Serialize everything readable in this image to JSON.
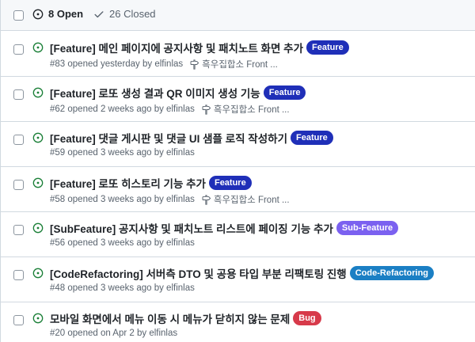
{
  "header": {
    "open_label": "8 Open",
    "closed_label": "26 Closed"
  },
  "issues": [
    {
      "title": "[Feature] 메인 페이지에 공지사항 및 패치노트 화면 추가",
      "label": "Feature",
      "label_color": "#1f2fb8",
      "meta": "#83 opened yesterday by elfinlas",
      "milestone": "흑우집합소 Front ..."
    },
    {
      "title": "[Feature] 로또 생성 결과 QR 이미지 생성 기능",
      "label": "Feature",
      "label_color": "#1f2fb8",
      "meta": "#62 opened 2 weeks ago by elfinlas",
      "milestone": "흑우집합소 Front ..."
    },
    {
      "title": "[Feature] 댓글 게시판 및 댓글 UI 샘플 로직 작성하기",
      "label": "Feature",
      "label_color": "#1f2fb8",
      "meta": "#59 opened 3 weeks ago by elfinlas",
      "milestone": ""
    },
    {
      "title": "[Feature] 로또 히스토리 기능 추가",
      "label": "Feature",
      "label_color": "#1f2fb8",
      "meta": "#58 opened 3 weeks ago by elfinlas",
      "milestone": "흑우집합소 Front ..."
    },
    {
      "title": "[SubFeature] 공지사항 및 패치노트 리스트에 페이징 기능 추가",
      "label": "Sub-Feature",
      "label_color": "#7b61f0",
      "meta": "#56 opened 3 weeks ago by elfinlas",
      "milestone": ""
    },
    {
      "title": "[CodeRefactoring] 서버측 DTO 및 공용 타입 부분 리팩토링 진행",
      "label": "Code-Refactoring",
      "label_color": "#1b7fc4",
      "meta": "#48 opened 3 weeks ago by elfinlas",
      "milestone": ""
    },
    {
      "title": "모바일 화면에서 메뉴 이동 시 메뉴가 닫히지 않는 문제",
      "label": "Bug",
      "label_color": "#d73a4a",
      "meta": "#20 opened on Apr 2 by elfinlas",
      "milestone": ""
    }
  ],
  "colors": {
    "open_green": "#1a7f37",
    "border": "#d1d9e0",
    "muted_text": "#59636e"
  }
}
